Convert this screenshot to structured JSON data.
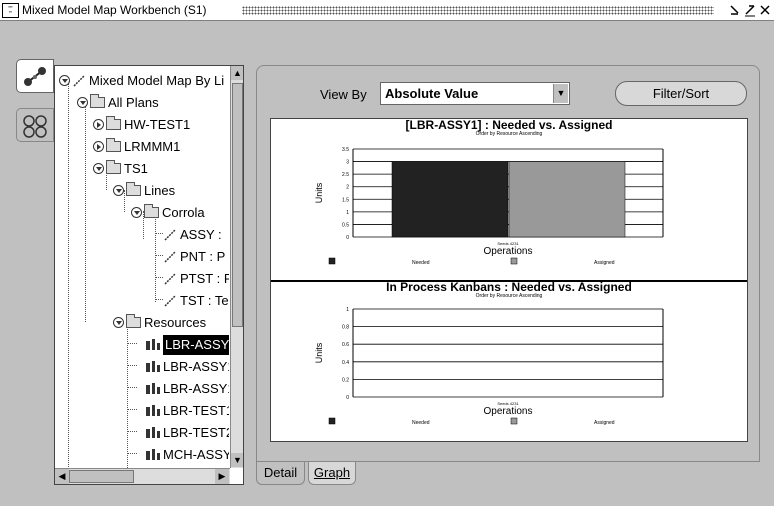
{
  "window": {
    "title": "Mixed Model Map Workbench (S1)",
    "controls": [
      "minimize-icon",
      "maximize-icon",
      "close-icon"
    ]
  },
  "side_tabs": [
    {
      "icon": "graph-nodes-icon",
      "active": true
    },
    {
      "icon": "resource-cluster-icon",
      "active": false
    }
  ],
  "tree": {
    "root": "Mixed Model Map By Li",
    "all_plans": "All Plans",
    "plans": [
      "HW-TEST1",
      "LRMMM1",
      "TS1"
    ],
    "lines_folder": "Lines",
    "line": "Corrola",
    "operations": [
      "ASSY : ",
      "PNT : P",
      "PTST : P",
      "TST : Te"
    ],
    "resources_folder": "Resources",
    "resources": [
      "LBR-ASSY",
      "LBR-ASSY1",
      "LBR-ASSY1",
      "LBR-TEST1",
      "LBR-TEST2",
      "MCH-ASSY"
    ],
    "selected_resource_index": 0
  },
  "toolbar": {
    "view_by_label": "View By",
    "view_by_value": "Absolute Value",
    "filter_button": "Filter/Sort"
  },
  "tabs": [
    {
      "label": "Detail",
      "active": false
    },
    {
      "label": "Graph",
      "active": true
    }
  ],
  "chart_data": [
    {
      "type": "bar",
      "title": "[LBR-ASSY1] : Needed vs. Assigned",
      "subtitle": "Order by Resource Ascending",
      "xlabel": "Operations",
      "ylabel": "Units",
      "categories": [
        "Seeds 4231"
      ],
      "yticks": [
        "3.5",
        "3",
        "2.5",
        "2",
        "1.5",
        "1",
        "0.5",
        "0"
      ],
      "ylim": [
        0,
        3.5
      ],
      "series": [
        {
          "name": "Needed",
          "values": [
            3
          ],
          "color": "#222222"
        },
        {
          "name": "Assigned",
          "values": [
            3
          ],
          "color": "#999999"
        }
      ],
      "legend": "bottom",
      "grid": true
    },
    {
      "type": "bar",
      "title": "In Process Kanbans : Needed vs. Assigned",
      "subtitle": "Order by Resource Ascending",
      "xlabel": "Operations",
      "ylabel": "Units",
      "categories": [
        "Seeds 4231"
      ],
      "yticks": [
        "1",
        "0.8",
        "0.6",
        "0.4",
        "0.2",
        "0"
      ],
      "ylim": [
        0,
        1
      ],
      "series": [
        {
          "name": "Needed",
          "values": [
            0
          ],
          "color": "#222222"
        },
        {
          "name": "Assigned",
          "values": [
            0
          ],
          "color": "#999999"
        }
      ],
      "legend": "bottom",
      "grid": true
    }
  ]
}
